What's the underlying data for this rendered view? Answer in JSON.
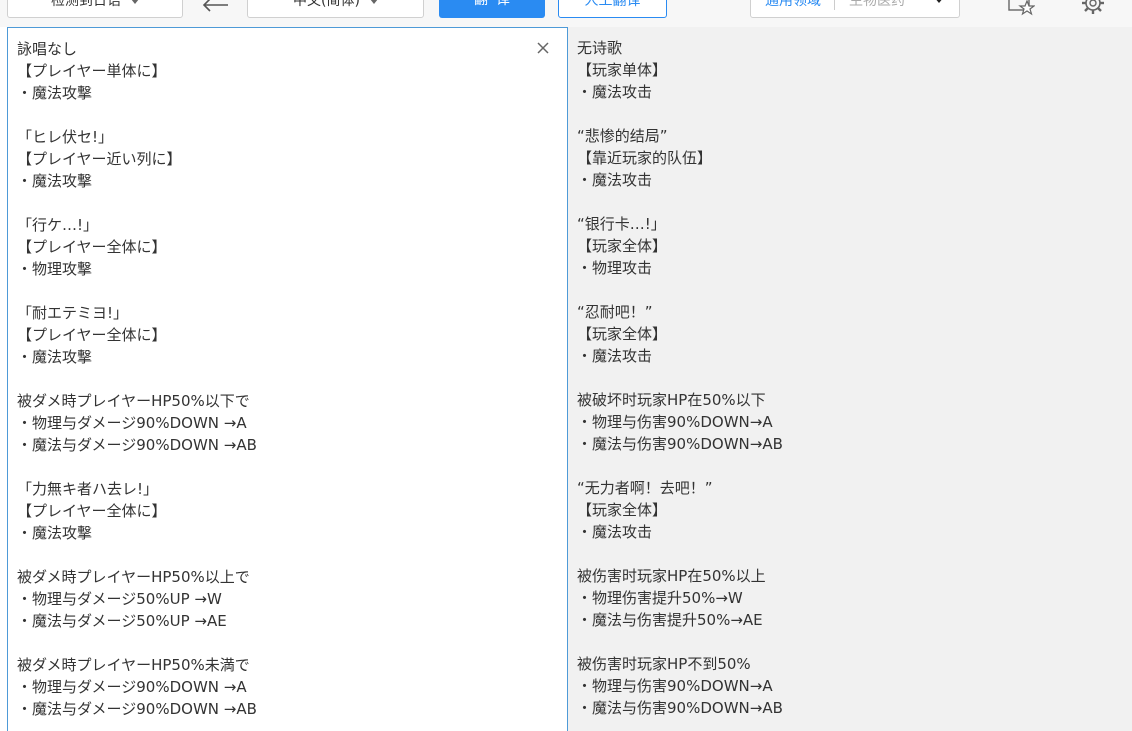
{
  "toolbar": {
    "source_language": "检测到日语",
    "target_language": "中文(简体)",
    "translate_label": "翻译",
    "human_translate_label": "人工翻译",
    "domain_general": "通用领域",
    "domain_selected": "生物医药"
  },
  "icons": {
    "swap": "swap-arrow-icon",
    "clear": "close-icon",
    "favorite": "star-favorite-icon",
    "settings": "gear-icon"
  },
  "source": {
    "lines": [
      "詠唱なし",
      "【プレイヤー単体に】",
      "・魔法攻撃",
      "",
      "「ヒレ伏セ!」",
      "【プレイヤー近い列に】",
      "・魔法攻撃",
      "",
      "「行ケ…!」",
      "【プレイヤー全体に】",
      "・物理攻撃",
      "",
      "「耐エテミヨ!」",
      "【プレイヤー全体に】",
      "・魔法攻撃",
      "",
      "被ダメ時プレイヤーHP50%以下で",
      "・物理与ダメージ90%DOWN →A",
      "・魔法与ダメージ90%DOWN →AB",
      "",
      "「力無キ者ハ去レ!」",
      "【プレイヤー全体に】",
      "・魔法攻撃",
      "",
      "被ダメ時プレイヤーHP50%以上で",
      "・物理与ダメージ50%UP →W",
      "・魔法与ダメージ50%UP →AE",
      "",
      "被ダメ時プレイヤーHP50%未満で",
      "・物理与ダメージ90%DOWN →A",
      "・魔法与ダメージ90%DOWN →AB"
    ]
  },
  "target": {
    "lines": [
      "无诗歌",
      "【玩家单体】",
      "・魔法攻击",
      "",
      "“悲惨的结局”",
      "【靠近玩家的队伍】",
      "・魔法攻击",
      "",
      "“银行卡…!」",
      "【玩家全体】",
      "・物理攻击",
      "",
      "“忍耐吧！”",
      "【玩家全体】",
      "・魔法攻击",
      "",
      "被破坏时玩家HP在50%以下",
      "・物理与伤害90%DOWN→A",
      "・魔法与伤害90%DOWN→AB",
      "",
      "“无力者啊！去吧！”",
      "【玩家全体】",
      "・魔法攻击",
      "",
      "被伤害时玩家HP在50%以上",
      "・物理伤害提升50%→W",
      "・魔法与伤害提升50%→AE",
      "",
      "被伤害时玩家HP不到50%",
      "・物理与伤害90%DOWN→A",
      "・魔法与伤害90%DOWN→AB"
    ]
  }
}
